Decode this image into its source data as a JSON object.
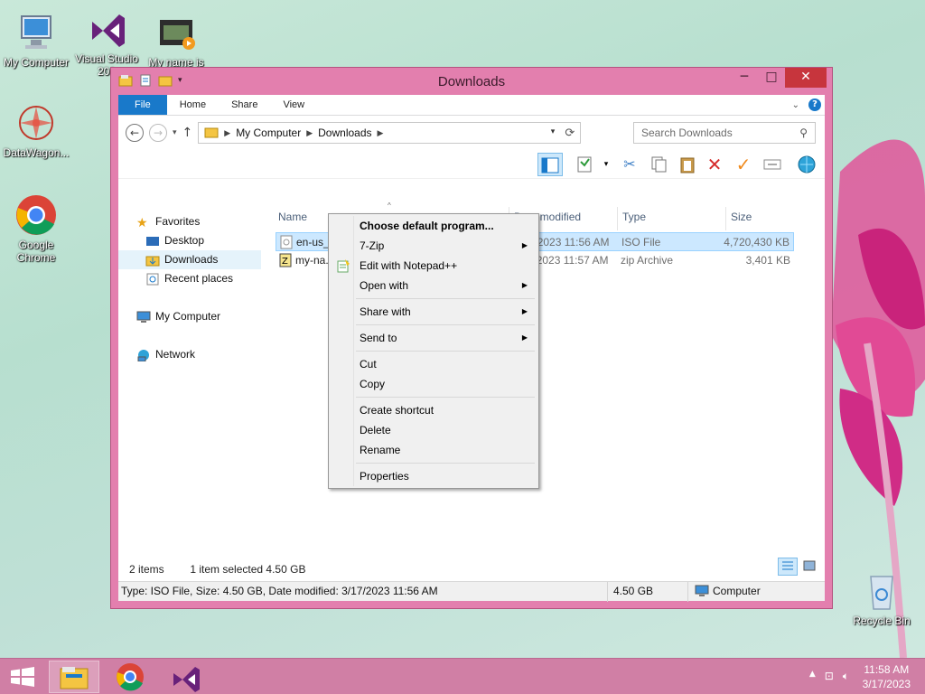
{
  "desktop": {
    "icons": [
      {
        "label": "My Computer"
      },
      {
        "label": "Visual Studio 201"
      },
      {
        "label": "My name is"
      },
      {
        "label": "DataWagon..."
      },
      {
        "label": "Google Chrome"
      },
      {
        "label": "Recycle Bin"
      }
    ]
  },
  "window": {
    "title": "Downloads",
    "controls": {
      "minimize": "─",
      "maximize": "□",
      "close": "✕"
    },
    "tabs": [
      "File",
      "Home",
      "Share",
      "View"
    ],
    "address": {
      "segments": [
        "My Computer",
        "Downloads"
      ]
    },
    "search_placeholder": "Search Downloads",
    "nav": {
      "favorites": "Favorites",
      "desktop": "Desktop",
      "downloads": "Downloads",
      "recent": "Recent places",
      "computer": "My Computer",
      "network": "Network"
    },
    "columns": [
      "Name",
      "Date modified",
      "Type",
      "Size"
    ],
    "files": [
      {
        "name": "en-us_win...",
        "date": "3/17/2023 11:56 AM",
        "type": "ISO File",
        "size": "4,720,430 KB"
      },
      {
        "name": "my-na...",
        "date": "3/17/2023 11:57 AM",
        "type": "zip Archive",
        "size": "3,401 KB"
      }
    ],
    "status": {
      "items": "2 items",
      "selected": "1 item selected  4.50 GB"
    },
    "details": {
      "info": "Type: ISO File, Size: 4.50 GB, Date modified: 3/17/2023 11:56 AM",
      "size": "4.50 GB",
      "location": "Computer"
    }
  },
  "context_menu": {
    "items": [
      {
        "label": "Choose default program..."
      },
      {
        "label": "7-Zip"
      },
      {
        "label": "Edit with Notepad++"
      },
      {
        "label": "Open with"
      },
      {
        "label": "Share with"
      },
      {
        "label": "Send to"
      },
      {
        "label": "Cut"
      },
      {
        "label": "Copy"
      },
      {
        "label": "Create shortcut"
      },
      {
        "label": "Delete"
      },
      {
        "label": "Rename"
      },
      {
        "label": "Properties"
      }
    ]
  },
  "taskbar": {
    "time": "11:58 AM",
    "date": "3/17/2023",
    "apps": [
      "windows-start",
      "file-explorer",
      "google-chrome",
      "visual-studio"
    ]
  },
  "colors": {
    "window_frame": "#e37fae",
    "accent": "#1979ca",
    "taskbar": "#d07fa5"
  }
}
